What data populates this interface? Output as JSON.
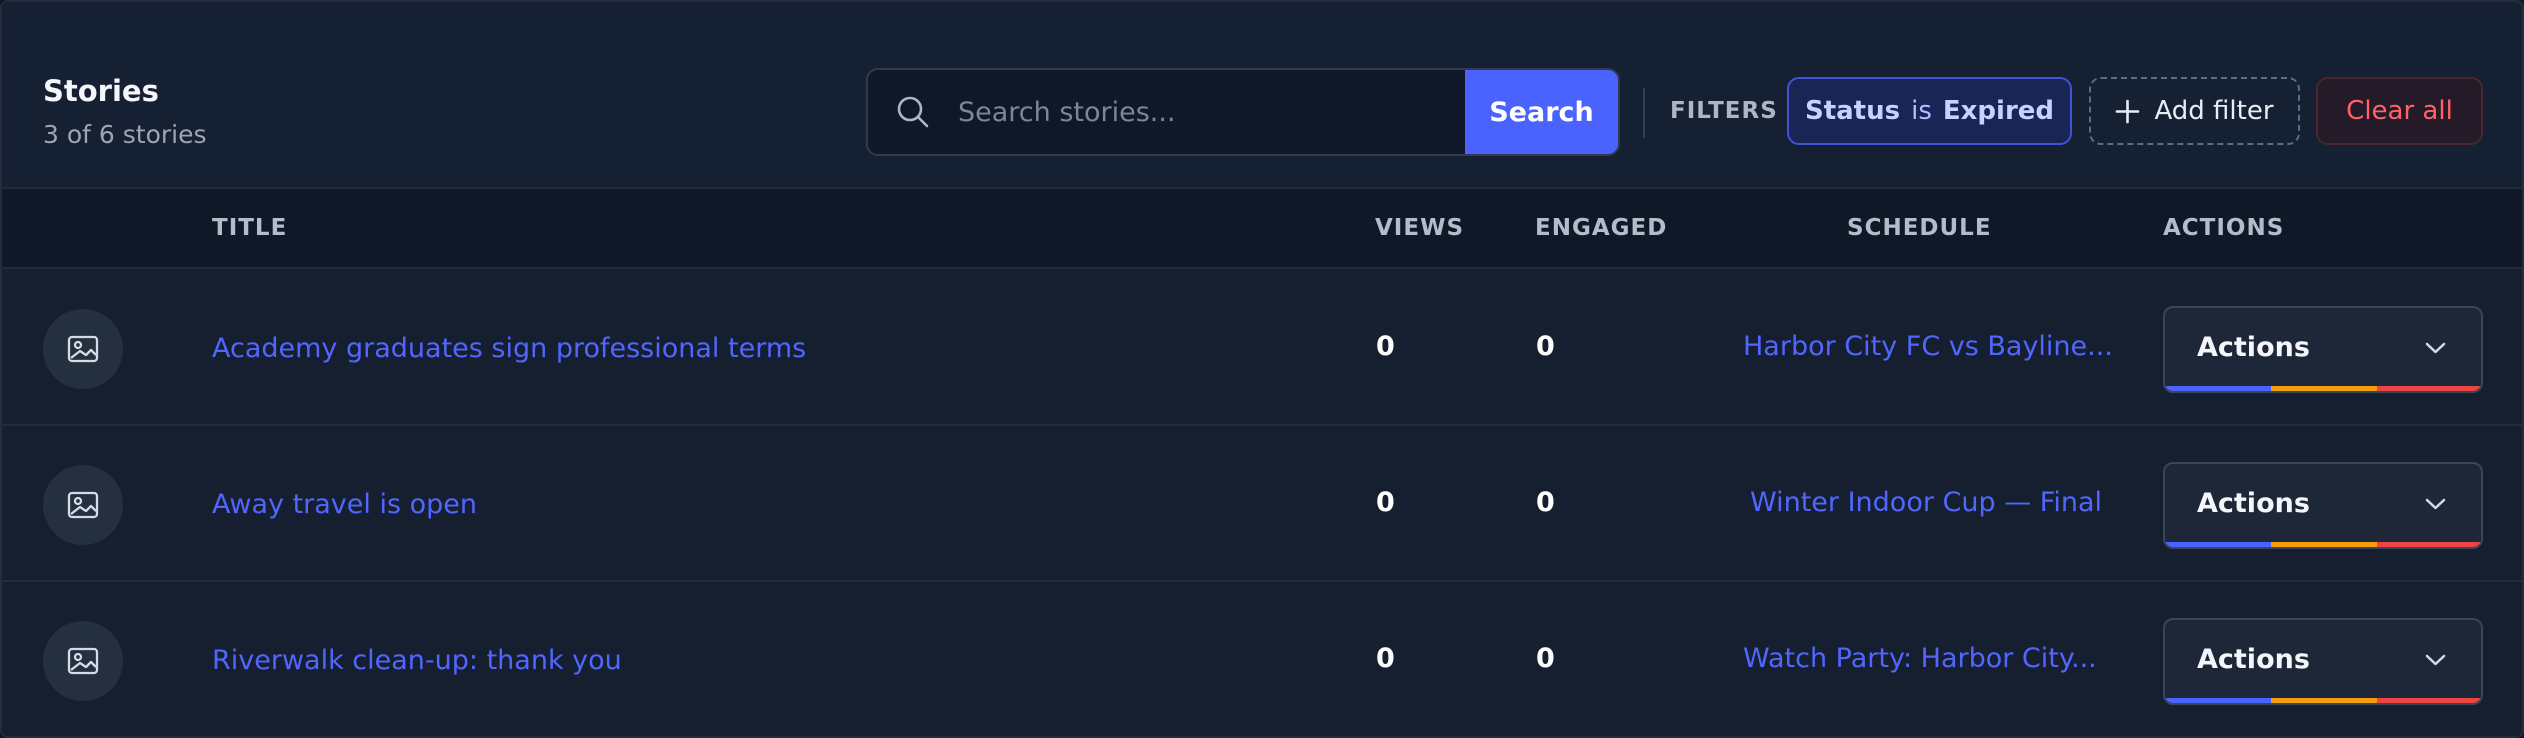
{
  "header": {
    "title": "Stories",
    "count_text": "3 of 6 stories"
  },
  "search": {
    "placeholder": "Search stories...",
    "value": "",
    "button_label": "Search"
  },
  "filters": {
    "label": "FILTERS",
    "chip": {
      "field": "Status",
      "operator": "is",
      "value": "Expired"
    },
    "add_label": "Add filter",
    "clear_label": "Clear all"
  },
  "table": {
    "columns": {
      "title": "TITLE",
      "views": "VIEWS",
      "engaged": "ENGAGED",
      "schedule": "SCHEDULE",
      "actions": "ACTIONS"
    },
    "rows": [
      {
        "title": "Academy graduates sign professional terms",
        "views": "0",
        "engaged": "0",
        "schedule": "Harbor City FC vs Bayline...",
        "action_label": "Actions"
      },
      {
        "title": "Away travel is open",
        "views": "0",
        "engaged": "0",
        "schedule": "Winter Indoor Cup — Final",
        "action_label": "Actions"
      },
      {
        "title": "Riverwalk clean-up: thank you",
        "views": "0",
        "engaged": "0",
        "schedule": "Watch Party: Harbor City...",
        "action_label": "Actions"
      }
    ]
  },
  "colors": {
    "accent": "#4a63ff",
    "link": "#5066ff",
    "danger": "#ff6268",
    "stripe_blue": "#4a63ff",
    "stripe_orange": "#f59e0b",
    "stripe_red": "#ef4444"
  },
  "icons": {
    "search": "search-icon",
    "plus": "plus-icon",
    "image": "image-icon",
    "chevron": "chevron-down-icon"
  }
}
